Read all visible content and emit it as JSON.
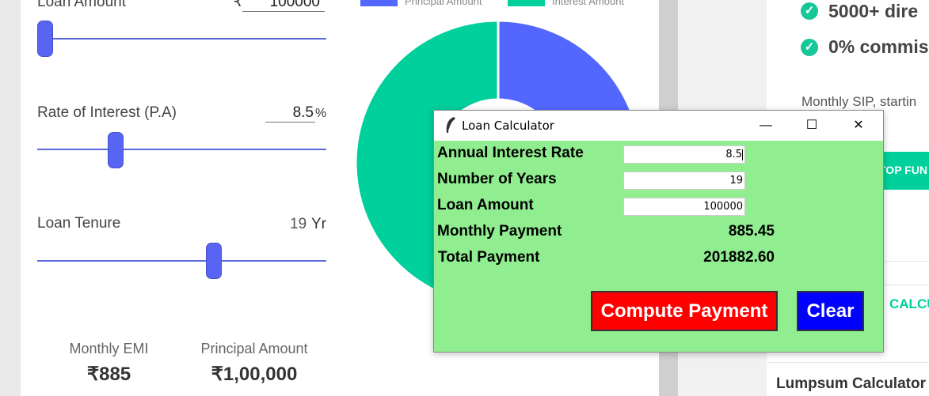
{
  "emi_calculator": {
    "loan_amount_label": "Loan Amount",
    "currency_symbol": "₹",
    "loan_amount_value": "100000",
    "rate_label": "Rate of Interest (P.A)",
    "rate_value": "8.5",
    "rate_unit": "%",
    "tenure_label": "Loan Tenure",
    "tenure_value": "19",
    "tenure_unit": "Yr",
    "stats": [
      {
        "label": "Monthly EMI",
        "value": "₹885"
      },
      {
        "label": "Principal Amount",
        "value": "₹1,00,000"
      }
    ]
  },
  "chart": {
    "legend": [
      {
        "label": "Principal Amount",
        "color": "#5367ff"
      },
      {
        "label": "Interest Amount",
        "color": "#00d09c"
      }
    ]
  },
  "chart_data": {
    "type": "pie",
    "categories": [
      "Principal Amount",
      "Interest Amount"
    ],
    "values": [
      100000,
      101882.6
    ],
    "colors": [
      "#5367ff",
      "#00d09c"
    ]
  },
  "right_panel": {
    "features": [
      "5000+ dire",
      "0% commis"
    ],
    "sip_text": "Monthly SIP, startin",
    "cta_label": "TOP FUN",
    "calc_link": "CALCU",
    "lumpsum_title": "Lumpsum Calculator"
  },
  "tk_window": {
    "title": "Loan Calculator",
    "minimize": "—",
    "maximize": "☐",
    "close": "✕",
    "labels": {
      "rate": "Annual Interest Rate",
      "years": "Number of Years",
      "amount": "Loan Amount",
      "monthly": "Monthly Payment",
      "total": "Total Payment"
    },
    "inputs": {
      "rate": "8.5",
      "years": "19",
      "amount": "100000"
    },
    "results": {
      "monthly": "885.45",
      "total": "201882.60"
    },
    "buttons": {
      "compute": "Compute Payment",
      "clear": "Clear"
    },
    "colors": {
      "body_bg": "#90ee90",
      "compute_bg": "#ff0000",
      "clear_bg": "#0000ff"
    }
  }
}
